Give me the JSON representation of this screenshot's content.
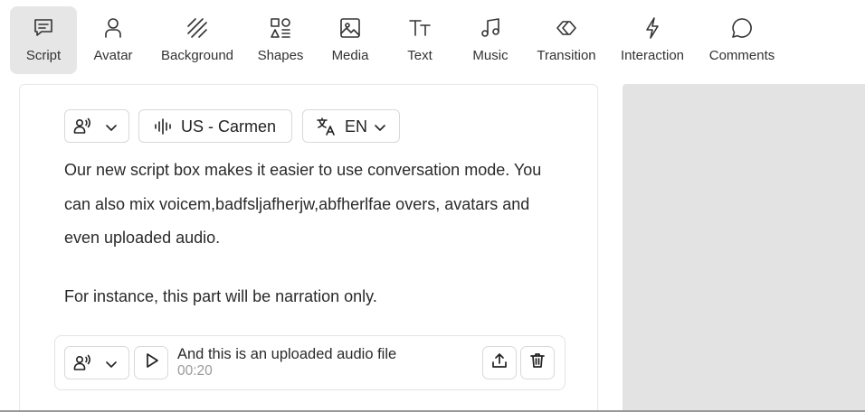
{
  "toolbar": {
    "items": [
      {
        "label": "Script",
        "icon": "script-icon",
        "active": true
      },
      {
        "label": "Avatar",
        "icon": "avatar-icon"
      },
      {
        "label": "Background",
        "icon": "background-icon"
      },
      {
        "label": "Shapes",
        "icon": "shapes-icon"
      },
      {
        "label": "Media",
        "icon": "media-icon"
      },
      {
        "label": "Text",
        "icon": "text-icon"
      },
      {
        "label": "Music",
        "icon": "music-icon"
      },
      {
        "label": "Transition",
        "icon": "transition-icon"
      },
      {
        "label": "Interaction",
        "icon": "interaction-icon"
      },
      {
        "label": "Comments",
        "icon": "comments-icon"
      }
    ]
  },
  "editor": {
    "voice_label": "US - Carmen",
    "language_label": "EN",
    "paragraph1": "Our new script box makes it easier to use conversation mode. You can also mix voicem,badfsljafherjw,abfherlfae overs, avatars and even uploaded audio.",
    "paragraph2": "For instance, this part will be narration only.",
    "audio": {
      "title": "And this is an uploaded audio file",
      "duration": "00:20"
    }
  },
  "colors": {
    "active_tab_bg": "#e6e6e6",
    "preview_bg": "#e3e3e3",
    "muted_text": "#9a9a9a"
  }
}
